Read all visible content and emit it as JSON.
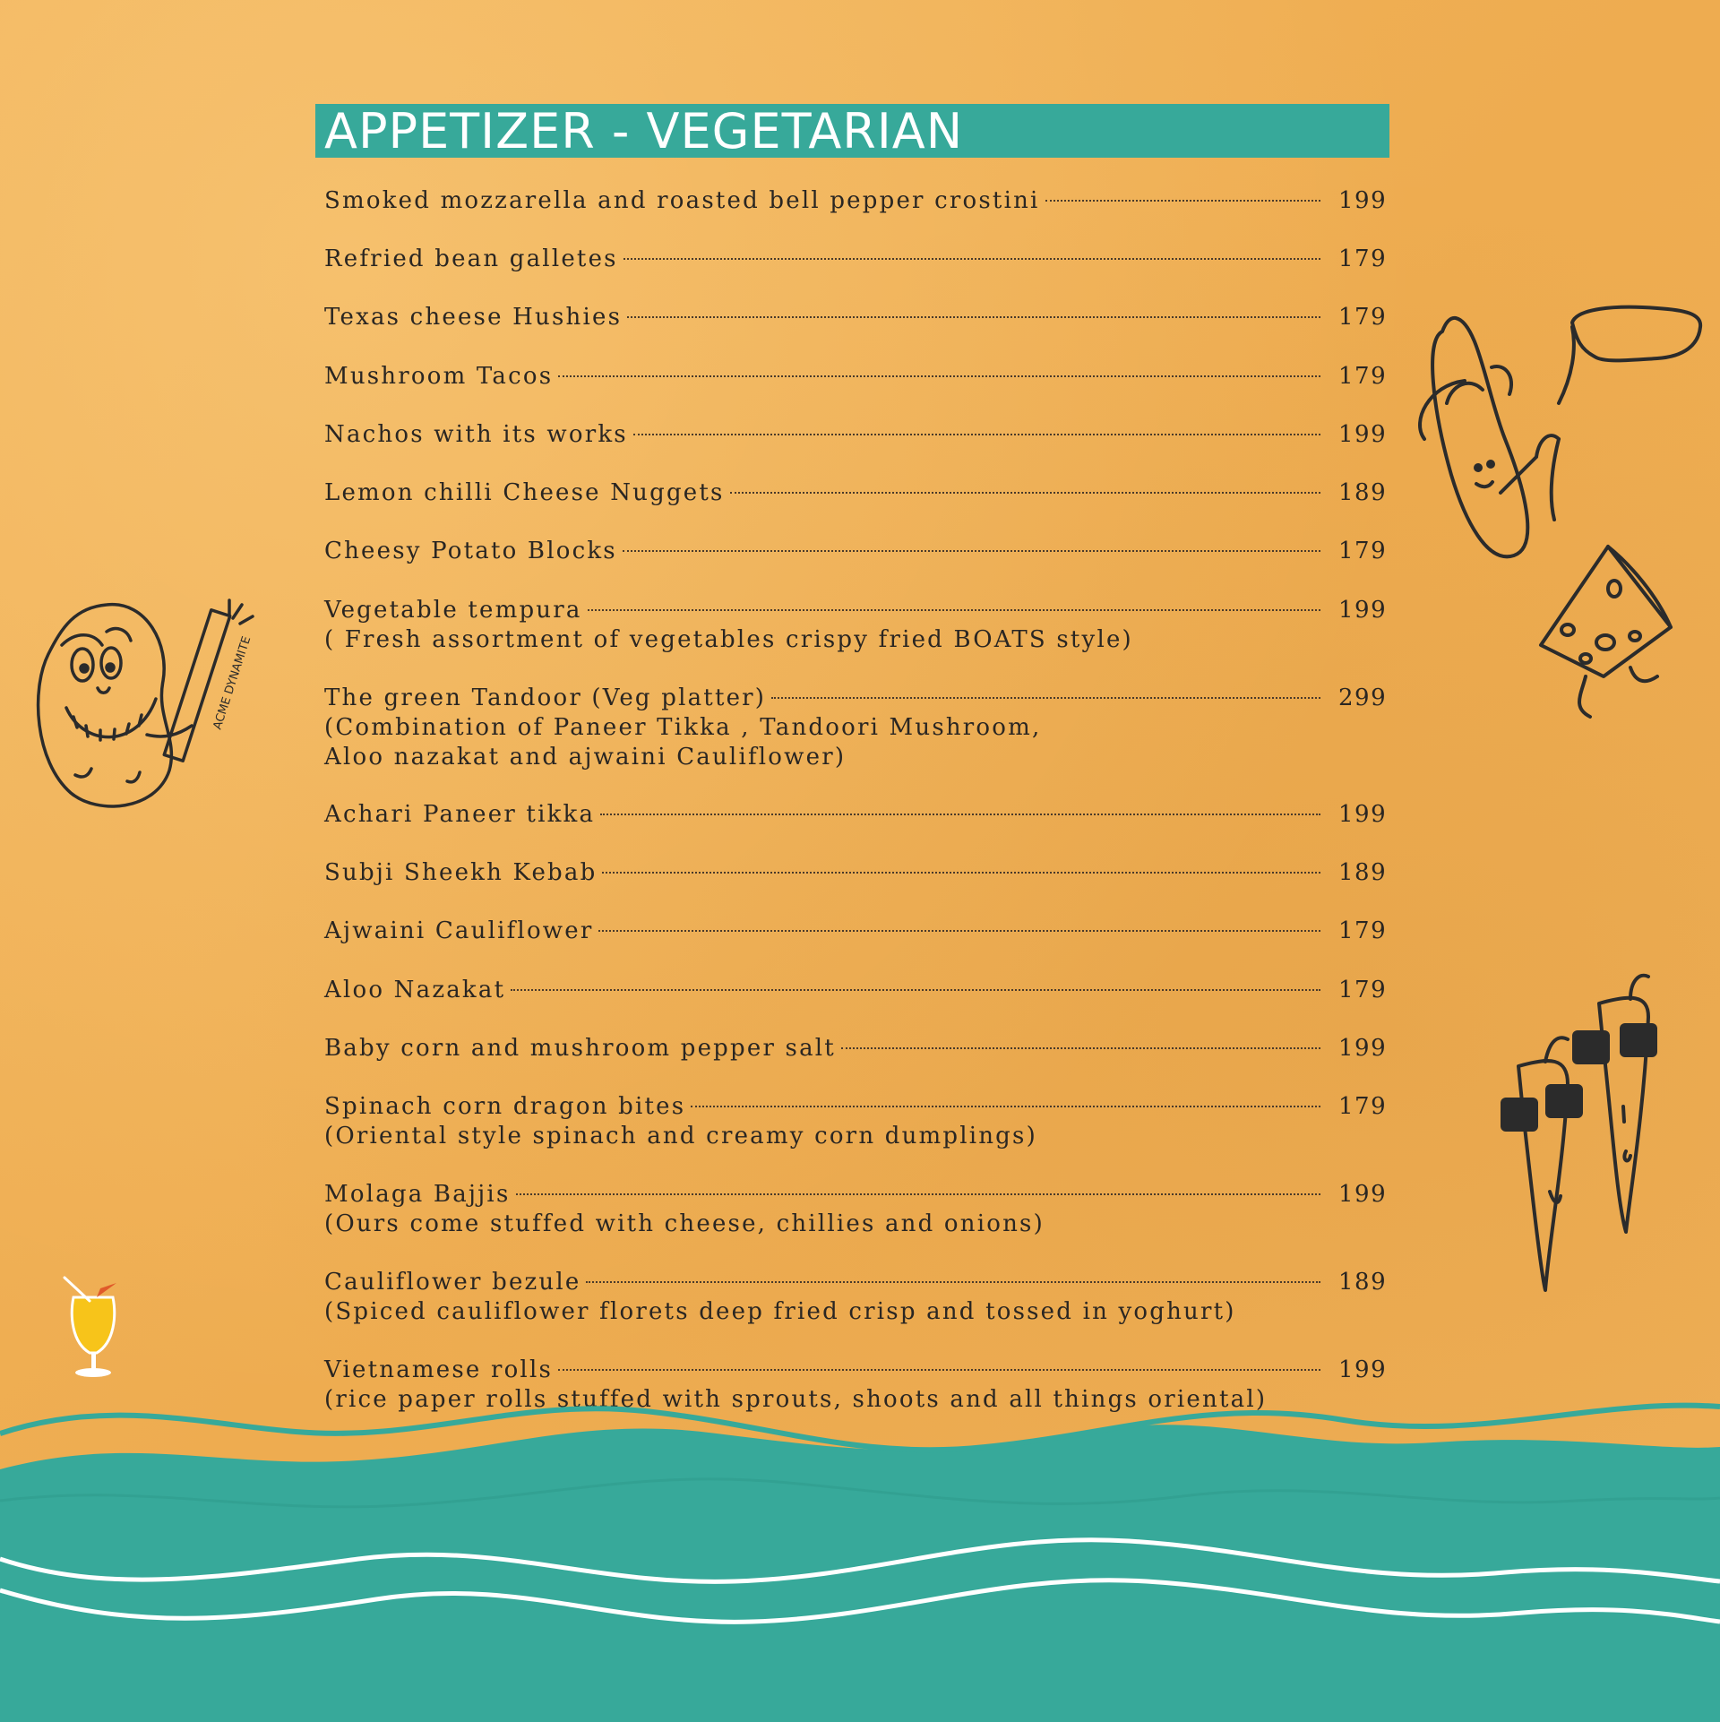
{
  "header": {
    "title": "APPETIZER - VEGETARIAN"
  },
  "items": [
    {
      "name": "Smoked mozzarella and roasted bell pepper crostini",
      "price": "199"
    },
    {
      "name": "Refried bean galletes",
      "price": "179"
    },
    {
      "name": "Texas cheese Hushies",
      "price": "179"
    },
    {
      "name": "Mushroom Tacos",
      "price": "179"
    },
    {
      "name": "Nachos with its works",
      "price": "199"
    },
    {
      "name": "Lemon chilli  Cheese Nuggets",
      "price": "189"
    },
    {
      "name": "Cheesy Potato Blocks",
      "price": "179"
    },
    {
      "name": "Vegetable tempura",
      "price": "199",
      "desc": [
        "( Fresh assortment of vegetables crispy fried BOATS style)"
      ]
    },
    {
      "name": "The green Tandoor (Veg platter)",
      "price": "299",
      "desc": [
        "(Combination of Paneer Tikka , Tandoori Mushroom,",
        "Aloo nazakat and  ajwaini Cauliflower)"
      ]
    },
    {
      "name": "Achari Paneer tikka",
      "price": "199"
    },
    {
      "name": "Subji Sheekh Kebab",
      "price": "189"
    },
    {
      "name": "Ajwaini Cauliflower",
      "price": "179"
    },
    {
      "name": "Aloo Nazakat",
      "price": "179"
    },
    {
      "name": "Baby corn and mushroom pepper salt",
      "price": "199"
    },
    {
      "name": "Spinach corn dragon bites",
      "price": "179",
      "desc": [
        "(Oriental style spinach and creamy corn dumplings)"
      ]
    },
    {
      "name": "Molaga Bajjis",
      "price": "199",
      "desc": [
        "(Ours come stuffed with cheese, chillies and onions)"
      ]
    },
    {
      "name": "Cauliflower bezule",
      "price": "189",
      "desc": [
        "(Spiced cauliflower florets deep fried crisp and tossed in yoghurt)"
      ]
    },
    {
      "name": "Vietnamese rolls",
      "price": "199",
      "desc": [
        "(rice paper rolls stuffed with sprouts, shoots and all things oriental)"
      ]
    }
  ],
  "doodles": {
    "potato_dynamite_label": "ACME DYNAMITE",
    "icons": [
      "potato-dynamite-icon",
      "banana-with-pipe-icon",
      "cheese-wedge-icon",
      "chillies-with-sunglasses-icon",
      "cocktail-glass-icon"
    ]
  },
  "colors": {
    "background": "#f0b055",
    "accent": "#37a99a",
    "text": "#2a2622",
    "ink": "#2b2b2b"
  }
}
